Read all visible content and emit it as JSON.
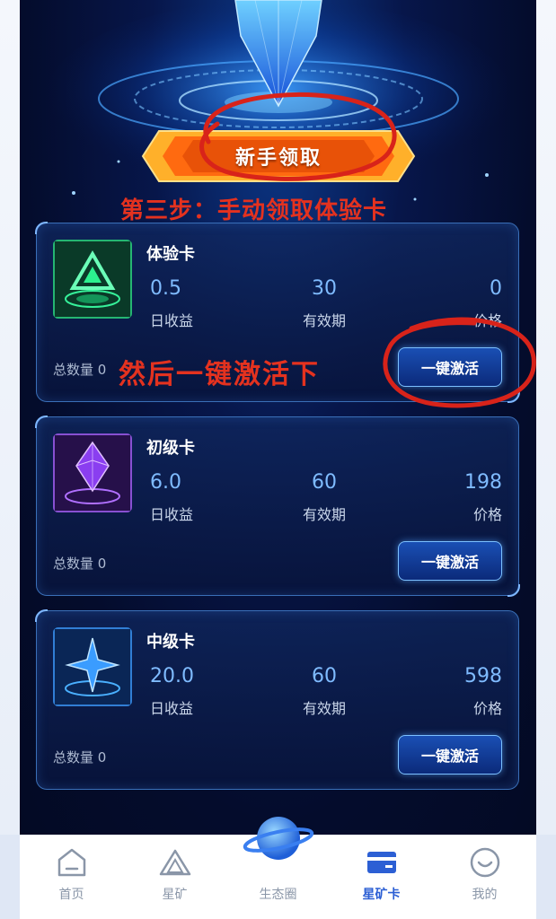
{
  "banner": {
    "claim_label": "新手领取",
    "step_note": "第三步：手动领取体验卡",
    "then_note": "然后一键激活下"
  },
  "cards": [
    {
      "name": "体验卡",
      "daily_income": "0.5",
      "daily_income_label": "日收益",
      "validity": "30",
      "validity_label": "有效期",
      "price": "0",
      "price_label": "价格",
      "total": "总数量 0",
      "button": "一键激活",
      "accent": "#19c46a"
    },
    {
      "name": "初级卡",
      "daily_income": "6.0",
      "daily_income_label": "日收益",
      "validity": "60",
      "validity_label": "有效期",
      "price": "198",
      "price_label": "价格",
      "total": "总数量 0",
      "button": "一键激活",
      "accent": "#9b4df0"
    },
    {
      "name": "中级卡",
      "daily_income": "20.0",
      "daily_income_label": "日收益",
      "validity": "60",
      "validity_label": "有效期",
      "price": "598",
      "price_label": "价格",
      "total": "总数量 0",
      "button": "一键激活",
      "accent": "#2f8cff"
    }
  ],
  "tabbar": {
    "items": [
      {
        "label": "首页",
        "icon": "home-icon"
      },
      {
        "label": "星矿",
        "icon": "triangle-mine-icon"
      },
      {
        "label": "生态圈",
        "icon": "planet-icon"
      },
      {
        "label": "星矿卡",
        "icon": "card-icon",
        "active": true
      },
      {
        "label": "我的",
        "icon": "smile-icon"
      }
    ],
    "active_color": "#2c5fd4",
    "inactive_color": "#8a96a8"
  },
  "colors": {
    "annotation_red": "#e4321f",
    "banner_orange": "#ff7a12"
  }
}
